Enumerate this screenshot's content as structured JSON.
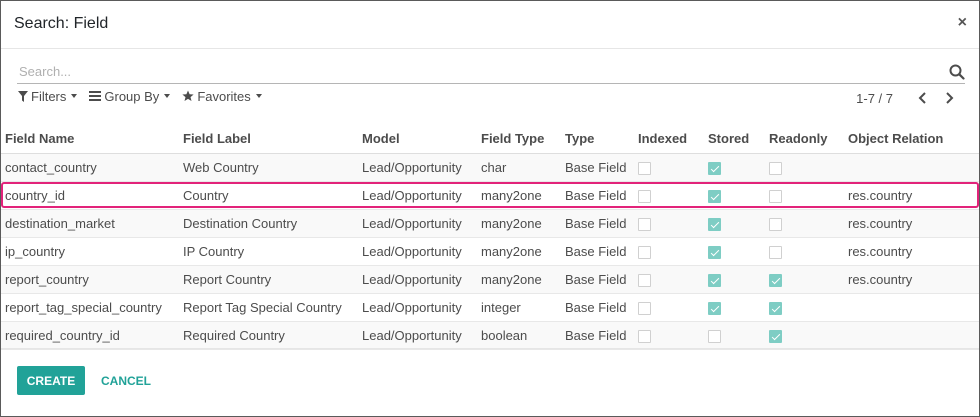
{
  "modal": {
    "title": "Search: Field",
    "close_symbol": "×"
  },
  "search": {
    "placeholder": "Search...",
    "value": ""
  },
  "filters": {
    "filters_label": "Filters",
    "group_by_label": "Group By",
    "favorites_label": "Favorites"
  },
  "pager": {
    "value": "1-7 / 7"
  },
  "table": {
    "headers": {
      "field_name": "Field Name",
      "field_label": "Field Label",
      "model": "Model",
      "field_type": "Field Type",
      "type": "Type",
      "indexed": "Indexed",
      "stored": "Stored",
      "readonly": "Readonly",
      "object_relation": "Object Relation"
    },
    "rows": [
      {
        "field_name": "contact_country",
        "field_label": "Web Country",
        "model": "Lead/Opportunity",
        "field_type": "char",
        "type": "Base Field",
        "indexed": false,
        "stored": true,
        "readonly": false,
        "object_relation": ""
      },
      {
        "field_name": "country_id",
        "field_label": "Country",
        "model": "Lead/Opportunity",
        "field_type": "many2one",
        "type": "Base Field",
        "indexed": false,
        "stored": true,
        "readonly": false,
        "object_relation": "res.country"
      },
      {
        "field_name": "destination_market",
        "field_label": "Destination Country",
        "model": "Lead/Opportunity",
        "field_type": "many2one",
        "type": "Base Field",
        "indexed": false,
        "stored": true,
        "readonly": false,
        "object_relation": "res.country"
      },
      {
        "field_name": "ip_country",
        "field_label": "IP Country",
        "model": "Lead/Opportunity",
        "field_type": "many2one",
        "type": "Base Field",
        "indexed": false,
        "stored": true,
        "readonly": false,
        "object_relation": "res.country"
      },
      {
        "field_name": "report_country",
        "field_label": "Report Country",
        "model": "Lead/Opportunity",
        "field_type": "many2one",
        "type": "Base Field",
        "indexed": false,
        "stored": true,
        "readonly": true,
        "object_relation": "res.country"
      },
      {
        "field_name": "report_tag_special_country",
        "field_label": "Report Tag Special Country",
        "model": "Lead/Opportunity",
        "field_type": "integer",
        "type": "Base Field",
        "indexed": false,
        "stored": true,
        "readonly": true,
        "object_relation": ""
      },
      {
        "field_name": "required_country_id",
        "field_label": "Required Country",
        "model": "Lead/Opportunity",
        "field_type": "boolean",
        "type": "Base Field",
        "indexed": false,
        "stored": false,
        "readonly": true,
        "object_relation": ""
      }
    ]
  },
  "footer": {
    "create_label": "CREATE",
    "cancel_label": "CANCEL"
  },
  "colors": {
    "accent": "#21a298",
    "checkbox_checked": "#7ecdc4",
    "highlight": "#e2237a"
  },
  "icons": {
    "search": "search-icon",
    "filter": "filter-icon",
    "group_by": "list-icon",
    "favorites": "star-icon",
    "prev": "chevron-left-icon",
    "next": "chevron-right-icon",
    "close": "close-icon"
  }
}
